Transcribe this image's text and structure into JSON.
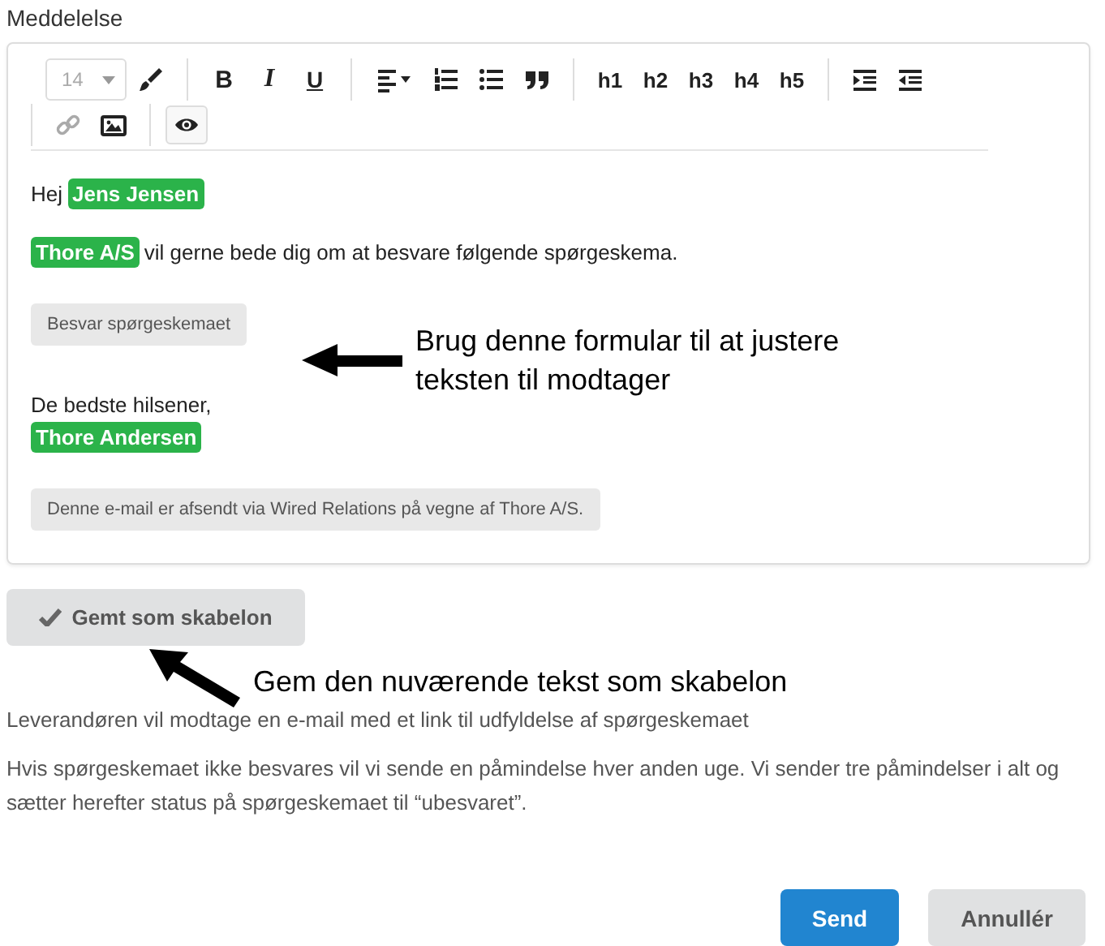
{
  "field_label": "Meddelelse",
  "toolbar": {
    "groups": [
      [
        {
          "kind": "select",
          "label": "14",
          "disabled": true
        },
        {
          "kind": "brush",
          "disabled": false,
          "selected": false
        }
      ],
      [
        {
          "kind": "bold",
          "label": "B",
          "disabled": false,
          "selected": false
        },
        {
          "kind": "italic",
          "label": "I",
          "disabled": false,
          "selected": false
        },
        {
          "kind": "underline",
          "label": "U",
          "disabled": false,
          "selected": false
        }
      ],
      [
        {
          "kind": "align",
          "disabled": false,
          "selected": false
        },
        {
          "kind": "ordered-list",
          "disabled": false,
          "selected": false
        },
        {
          "kind": "bullet-list",
          "disabled": false,
          "selected": false
        },
        {
          "kind": "quote",
          "disabled": false,
          "selected": false
        }
      ],
      [
        {
          "kind": "heading",
          "label": "h1",
          "disabled": false,
          "selected": false
        },
        {
          "kind": "heading",
          "label": "h2",
          "disabled": false,
          "selected": false
        },
        {
          "kind": "heading",
          "label": "h3",
          "disabled": false,
          "selected": false
        },
        {
          "kind": "heading",
          "label": "h4",
          "disabled": false,
          "selected": false
        },
        {
          "kind": "heading",
          "label": "h5",
          "disabled": false,
          "selected": false
        }
      ],
      [
        {
          "kind": "indent",
          "disabled": false,
          "selected": false
        },
        {
          "kind": "outdent",
          "disabled": false,
          "selected": false
        }
      ],
      [
        {
          "kind": "link",
          "disabled": true,
          "selected": false
        },
        {
          "kind": "image",
          "disabled": false,
          "selected": false
        }
      ],
      [
        {
          "kind": "preview",
          "disabled": false,
          "selected": true
        }
      ]
    ]
  },
  "body": [
    {
      "kind": "text",
      "lines": [
        [
          {
            "text": "Hej",
            "highlighted": false
          },
          {
            "text": "Jens Jensen",
            "highlighted": true
          }
        ]
      ]
    },
    {
      "kind": "text",
      "lines": [
        [
          {
            "text": "Thore A/S",
            "highlighted": true
          },
          {
            "text": "vil gerne bede dig om at besvare følgende spørgeskema.",
            "highlighted": false
          }
        ]
      ]
    },
    {
      "kind": "button",
      "text": "Besvar spørgeskemaet"
    },
    {
      "kind": "text",
      "lines": [
        [
          {
            "text": "De bedste hilsener,",
            "highlighted": false
          }
        ],
        [
          {
            "text": "Thore Andersen",
            "highlighted": true
          }
        ]
      ]
    },
    {
      "kind": "button",
      "text": "Denne e-mail er afsendt via Wired Relations på vegne af Thore A/S."
    }
  ],
  "template_button": {
    "label": "Gemt som skabelon",
    "saved": true
  },
  "annotations": [
    {
      "text": "Brug denne formular til at justere teksten til modtager",
      "kind": "arrow-left"
    },
    {
      "text": "Gem den nuværende tekst som skabelon",
      "kind": "arrow-up-left"
    }
  ],
  "info_text": "Leverandøren vil modtage en e-mail med et link til udfyldelse af spørgeskemaet",
  "reminder_text": "Hvis spørgeskemaet ikke besvares vil vi sende en påmindelse hver anden uge. Vi sender tre påmindelser i alt og sætter herefter status på spørgeskemaet til “ubesvaret”.",
  "buttons": [
    {
      "label": "Send",
      "kind": "primary"
    },
    {
      "label": "Annullér",
      "kind": "secondary"
    }
  ]
}
